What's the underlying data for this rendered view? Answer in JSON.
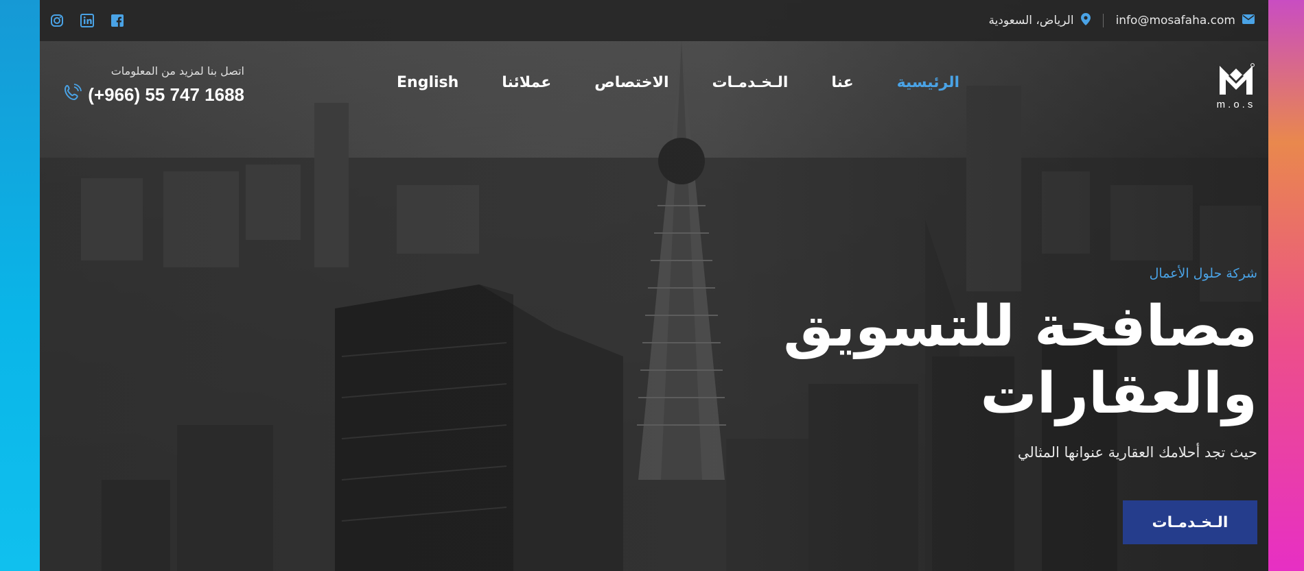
{
  "topbar": {
    "email": "info@mosafaha.com",
    "location": "الرياض، السعودية",
    "socials": [
      {
        "name": "instagram",
        "icon": "instagram-icon"
      },
      {
        "name": "linkedin",
        "icon": "linkedin-icon"
      },
      {
        "name": "facebook",
        "icon": "facebook-icon"
      }
    ]
  },
  "header": {
    "logo_text": "m.o.s",
    "call_label": "اتصل بنا لمزيد من المعلومات",
    "phone": "(+966) 55 747 1688",
    "nav": [
      {
        "label": "الرئيسية",
        "active": true
      },
      {
        "label": "عنا",
        "active": false
      },
      {
        "label": "الـخـدمـات",
        "active": false
      },
      {
        "label": "الاختصاص",
        "active": false
      },
      {
        "label": "عملائنا",
        "active": false
      },
      {
        "label": "English",
        "active": false
      }
    ]
  },
  "hero": {
    "eyebrow": "شركة حلول الأعمال",
    "headline_line1": "مصافحة للتسويق",
    "headline_line2": "والعقارات",
    "subline": "حيث تجد أحلامك العقارية عنوانها المثالي",
    "cta_label": "الـخـدمـات"
  },
  "colors": {
    "accent": "#4aa3e6",
    "cta_bg": "#253d8c",
    "topbar_bg": "#262626"
  }
}
